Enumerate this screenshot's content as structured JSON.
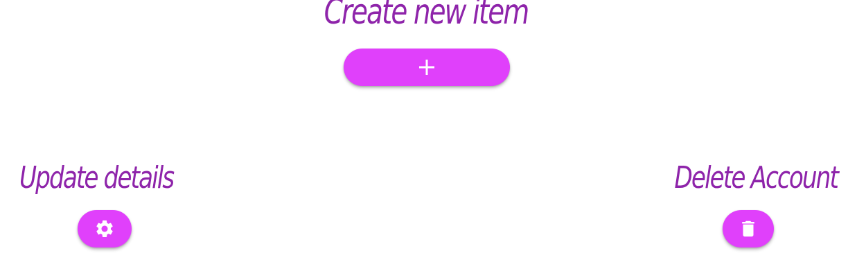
{
  "create": {
    "heading": "Create new item",
    "button_icon": "plus-icon"
  },
  "update": {
    "heading": "Update details",
    "button_icon": "gear-icon"
  },
  "delete": {
    "heading": "Delete Account",
    "button_icon": "trash-icon"
  },
  "colors": {
    "heading": "#8e24aa",
    "button": "#e040fb",
    "icon": "#ffffff"
  }
}
